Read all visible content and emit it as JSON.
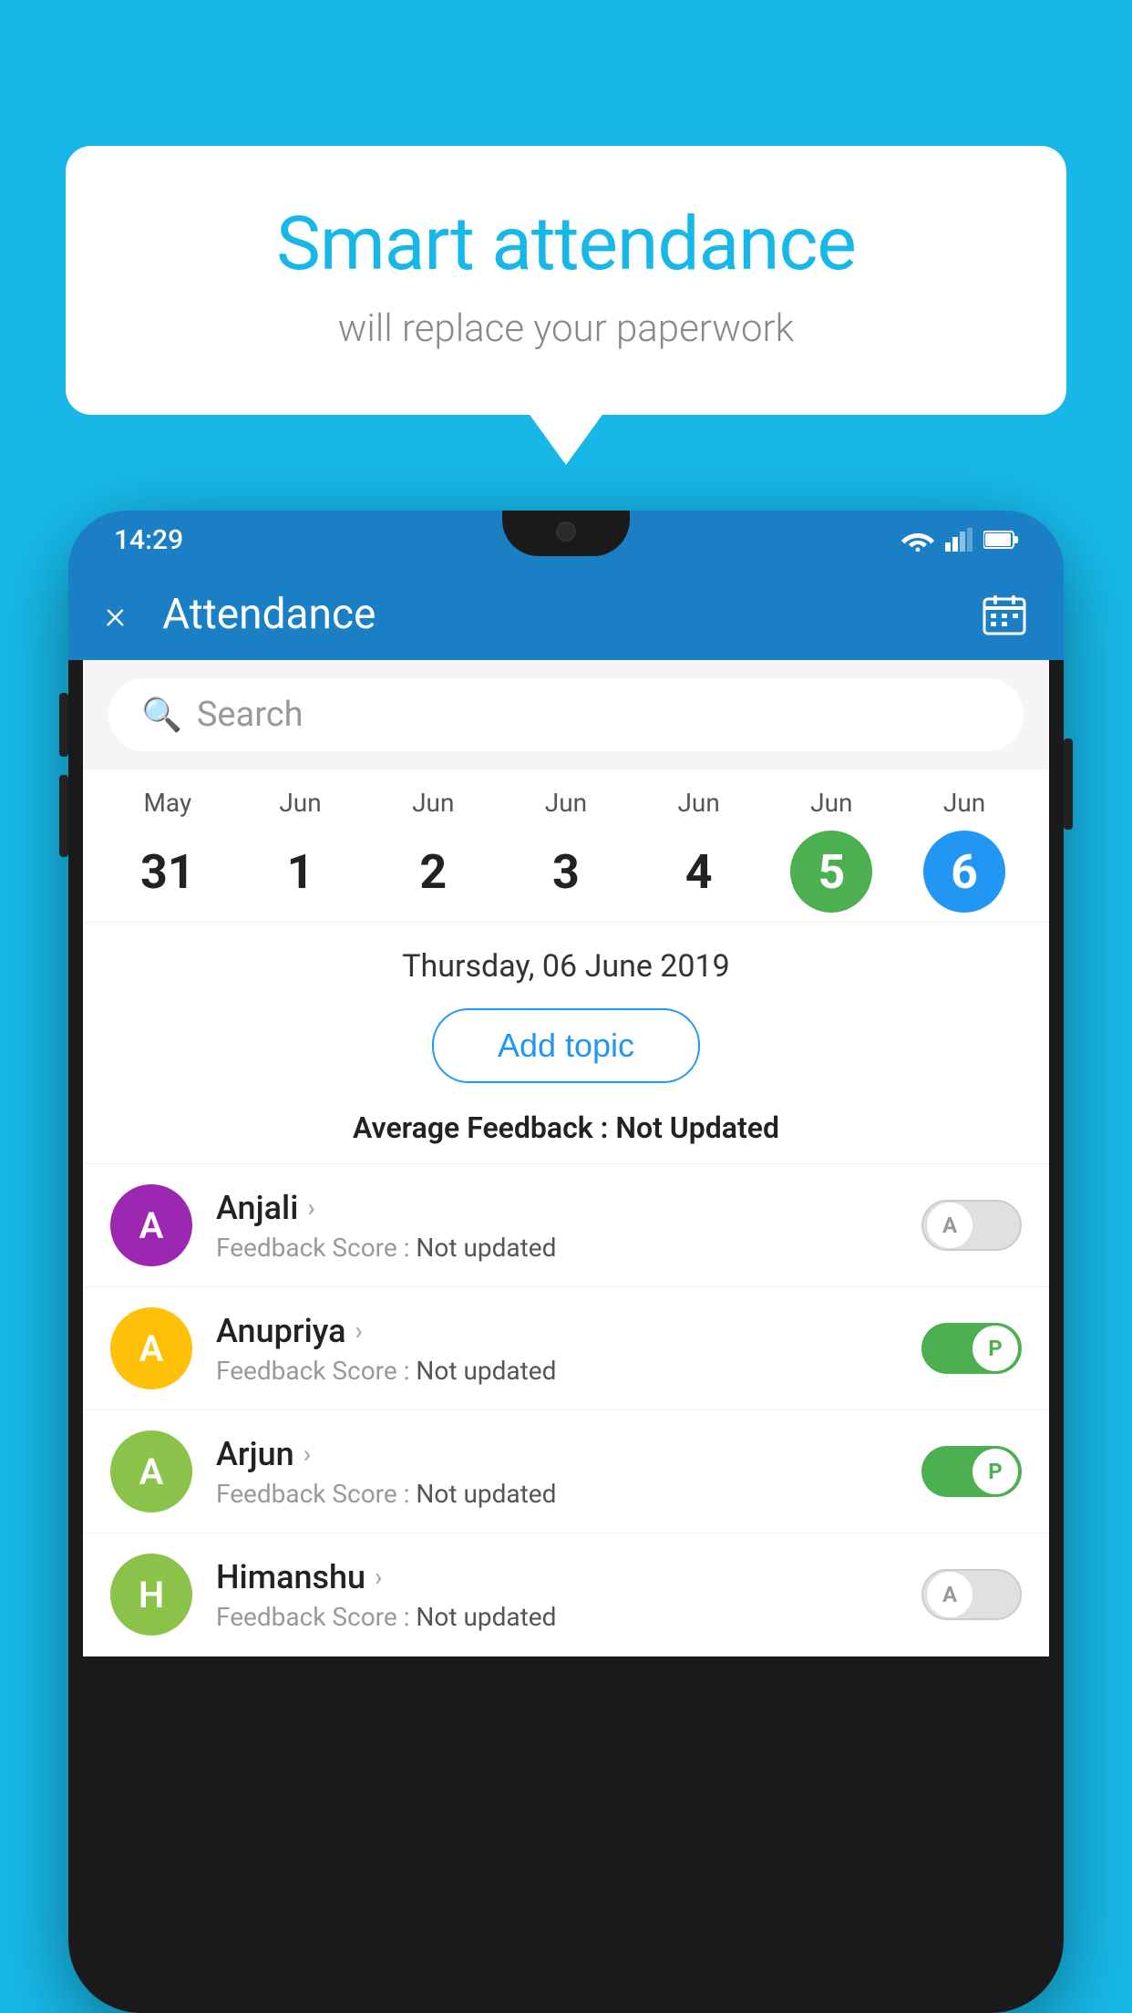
{
  "background_color": "#17b8e8",
  "bubble": {
    "title": "Smart attendance",
    "subtitle": "will replace your paperwork"
  },
  "app": {
    "status_time": "14:29",
    "title": "Attendance",
    "close_label": "×",
    "search_placeholder": "Search",
    "selected_date_label": "Thursday, 06 June 2019",
    "add_topic_label": "Add topic",
    "avg_feedback_label": "Average Feedback : ",
    "avg_feedback_value": "Not Updated"
  },
  "dates": [
    {
      "month": "May",
      "day": "31",
      "state": "normal"
    },
    {
      "month": "Jun",
      "day": "1",
      "state": "normal"
    },
    {
      "month": "Jun",
      "day": "2",
      "state": "normal"
    },
    {
      "month": "Jun",
      "day": "3",
      "state": "normal"
    },
    {
      "month": "Jun",
      "day": "4",
      "state": "normal"
    },
    {
      "month": "Jun",
      "day": "5",
      "state": "today"
    },
    {
      "month": "Jun",
      "day": "6",
      "state": "selected"
    }
  ],
  "students": [
    {
      "name": "Anjali",
      "initial": "A",
      "avatar_color": "#9c27b0",
      "feedback": "Feedback Score : ",
      "feedback_value": "Not updated",
      "toggle": "off",
      "toggle_label": "A"
    },
    {
      "name": "Anupriya",
      "initial": "A",
      "avatar_color": "#ffc107",
      "feedback": "Feedback Score : ",
      "feedback_value": "Not updated",
      "toggle": "on",
      "toggle_label": "P"
    },
    {
      "name": "Arjun",
      "initial": "A",
      "avatar_color": "#8bc34a",
      "feedback": "Feedback Score : ",
      "feedback_value": "Not updated",
      "toggle": "on",
      "toggle_label": "P"
    },
    {
      "name": "Himanshu",
      "initial": "H",
      "avatar_color": "#8bc34a",
      "feedback": "Feedback Score : ",
      "feedback_value": "Not updated",
      "toggle": "off",
      "toggle_label": "A"
    }
  ]
}
